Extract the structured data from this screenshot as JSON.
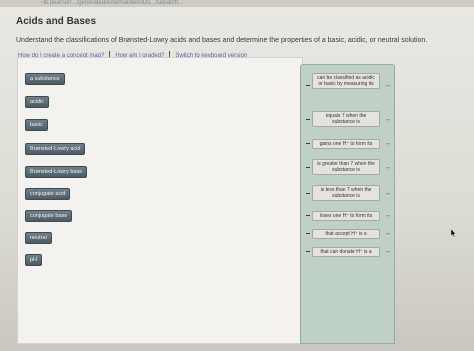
{
  "browser": {
    "url_text": "~lb.pearson.../generated/external/itemIDs.../sepatch..."
  },
  "header": {
    "title": "Acids and Bases",
    "instructions": "Understand the classifications of Brønsted-Lowry acids and bases and determine the properties of a basic, acidic, or neutral solution."
  },
  "links": {
    "concept_map": "How do I create a concept map?",
    "graded": "How am I graded?",
    "keyboard": "Switch to keyboard version"
  },
  "terms": [
    {
      "label": "a substance"
    },
    {
      "label": "acidic"
    },
    {
      "label": "basic"
    },
    {
      "label": "Brønsted-Lowry acid"
    },
    {
      "label": "Brønsted-Lowry base"
    },
    {
      "label": "conjugate acid"
    },
    {
      "label": "conjugate base"
    },
    {
      "label": "neutral"
    },
    {
      "label": "pH"
    }
  ],
  "targets": [
    {
      "text": "can be classified as acidic or basic by measuring its"
    },
    {
      "text": "equals 7 when the substance is"
    },
    {
      "text": "gains one H⁺ to form its"
    },
    {
      "text": "is greater than 7 when the substance is"
    },
    {
      "text": "is less than 7 when the substance is"
    },
    {
      "text": "loses one H⁺ to form its"
    },
    {
      "text": "that accept H⁺ is a"
    },
    {
      "text": "that can donate H⁺ is a"
    }
  ],
  "icons": {
    "arrow": "→",
    "dash": "—"
  },
  "colors": {
    "term_bg": "#56656d",
    "target_panel_bg": "#bfd0c7",
    "link": "#5d5fa4"
  }
}
